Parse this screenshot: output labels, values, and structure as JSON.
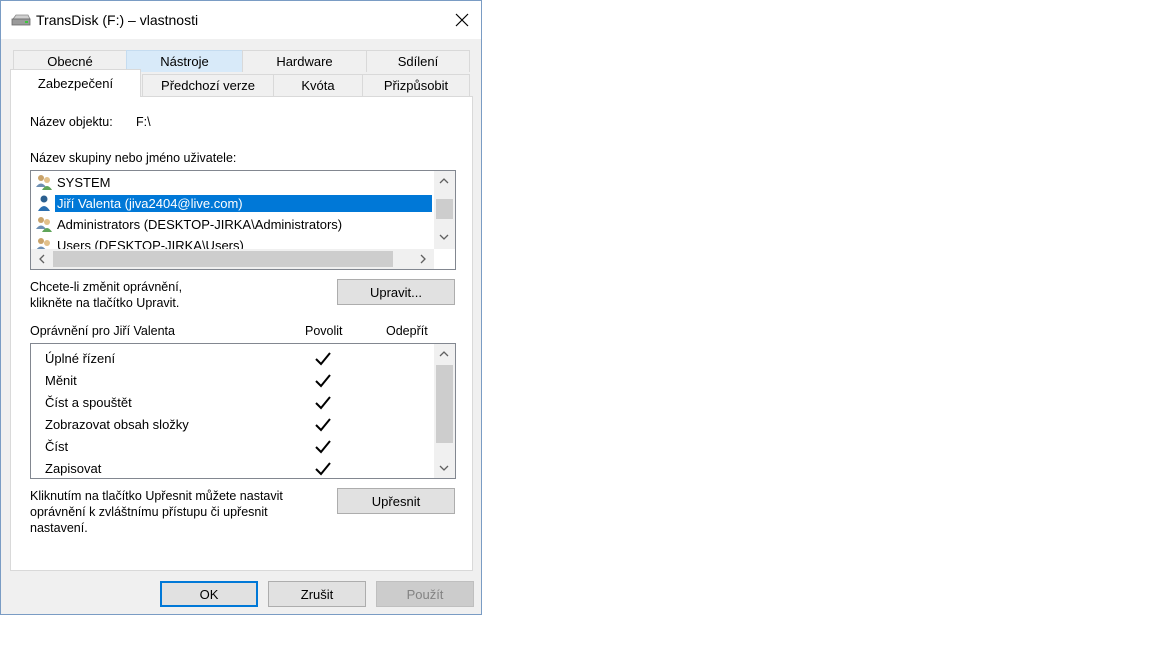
{
  "window": {
    "title": "TransDisk (F:) – vlastnosti",
    "close_label": "Zavřít"
  },
  "tabs": {
    "row1": [
      "Obecné",
      "Nástroje",
      "Hardware",
      "Sdílení"
    ],
    "row2": [
      "Zabezpečení",
      "Předchozí verze",
      "Kvóta",
      "Přizpůsobit"
    ],
    "active": "Zabezpečení",
    "hovered": "Nástroje"
  },
  "security": {
    "object_label": "Název objektu:",
    "object_value": "F:\\",
    "group_list_label": "Název skupiny nebo jméno uživatele:",
    "users": [
      {
        "name": "SYSTEM",
        "icon": "user-group-icon"
      },
      {
        "name": "Jiří Valenta (jiva2404@live.com)",
        "icon": "user-icon",
        "selected": true
      },
      {
        "name": "Administrators (DESKTOP-JIRKA\\Administrators)",
        "icon": "user-group-icon"
      },
      {
        "name": "Users (DESKTOP-JIRKA\\Users)",
        "icon": "user-group-icon"
      }
    ],
    "edit_hint_line1": "Chcete-li změnit oprávnění,",
    "edit_hint_line2": "klikněte na tlačítko Upravit.",
    "edit_button": "Upravit...",
    "permissions_for_label": "Oprávnění pro Jiří Valenta",
    "col_allow": "Povolit",
    "col_deny": "Odepřít",
    "permissions": [
      {
        "name": "Úplné řízení",
        "allow": true,
        "deny": false
      },
      {
        "name": "Měnit",
        "allow": true,
        "deny": false
      },
      {
        "name": "Číst a spouštět",
        "allow": true,
        "deny": false
      },
      {
        "name": "Zobrazovat obsah složky",
        "allow": true,
        "deny": false
      },
      {
        "name": "Číst",
        "allow": true,
        "deny": false
      },
      {
        "name": "Zapisovat",
        "allow": true,
        "deny": false
      }
    ],
    "advanced_hint_line1": "Kliknutím na tlačítko Upřesnit můžete nastavit",
    "advanced_hint_line2": "oprávnění k zvláštnímu přístupu či upřesnit",
    "advanced_hint_line3": "nastavení.",
    "advanced_button": "Upřesnit"
  },
  "footer": {
    "ok": "OK",
    "cancel": "Zrušit",
    "apply": "Použít"
  },
  "colors": {
    "selection": "#0078d7",
    "tab_hover": "#d8eaf9",
    "window_border": "#7a9cc4"
  }
}
